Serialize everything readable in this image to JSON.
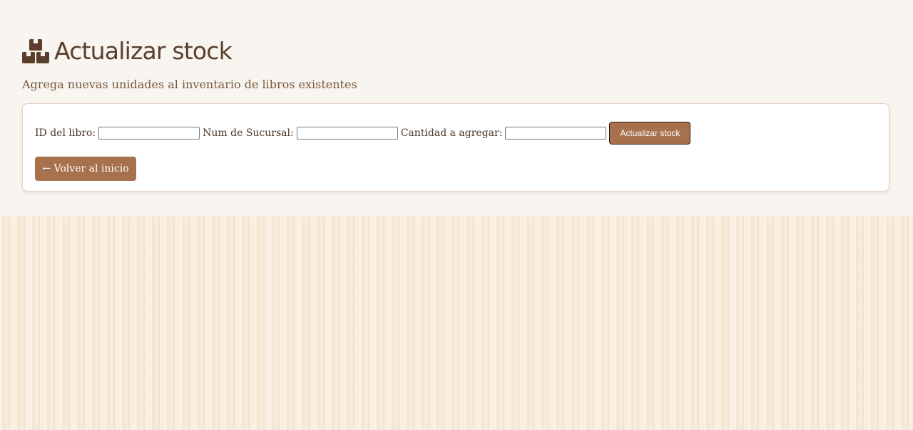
{
  "header": {
    "icon": "boxes-icon",
    "title": "Actualizar stock",
    "subtitle": "Agrega nuevas unidades al inventario de libros existentes"
  },
  "form": {
    "book_id_label": "ID del libro:",
    "book_id_value": "",
    "branch_label": "Num de Sucursal:",
    "branch_value": "",
    "quantity_label": "Cantidad a agregar:",
    "quantity_value": "",
    "submit_label": "Actualizar stock"
  },
  "back_button": {
    "label": "← Volver al inicio"
  },
  "colors": {
    "accent": "#a8714e",
    "title": "#5a3e2b",
    "page_background": "#f8f4ef"
  }
}
